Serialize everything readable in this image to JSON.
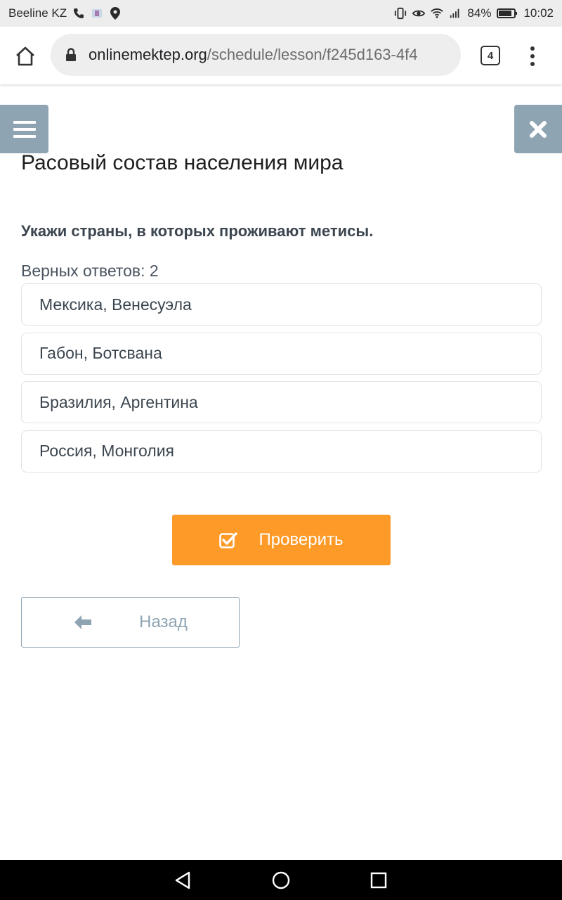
{
  "status_bar": {
    "carrier": "Beeline KZ",
    "battery": "84%",
    "time": "10:02",
    "icons": [
      "phone-icon",
      "app-icon",
      "location-icon",
      "vibrate-icon",
      "eye-icon",
      "wifi-icon",
      "signal-icon",
      "battery-icon"
    ]
  },
  "browser": {
    "url_host": "onlinemektep.org",
    "url_path": "/schedule/lesson/f245d163-4f4",
    "tab_count": "4"
  },
  "lesson": {
    "title": "Расовый состав населения мира",
    "question": "Укажи страны, в которых проживают метисы.",
    "correct_answers_label": "Верных ответов: 2",
    "options": [
      "Мексика, Венесуэла",
      "Габон, Ботсвана",
      "Бразилия, Аргентина",
      "Россия, Монголия"
    ],
    "check_label": "Проверить",
    "back_label": "Назад"
  },
  "colors": {
    "accent_orange": "#fd9a28",
    "slate_button": "#8fa4b3",
    "text": "#3c4650"
  }
}
